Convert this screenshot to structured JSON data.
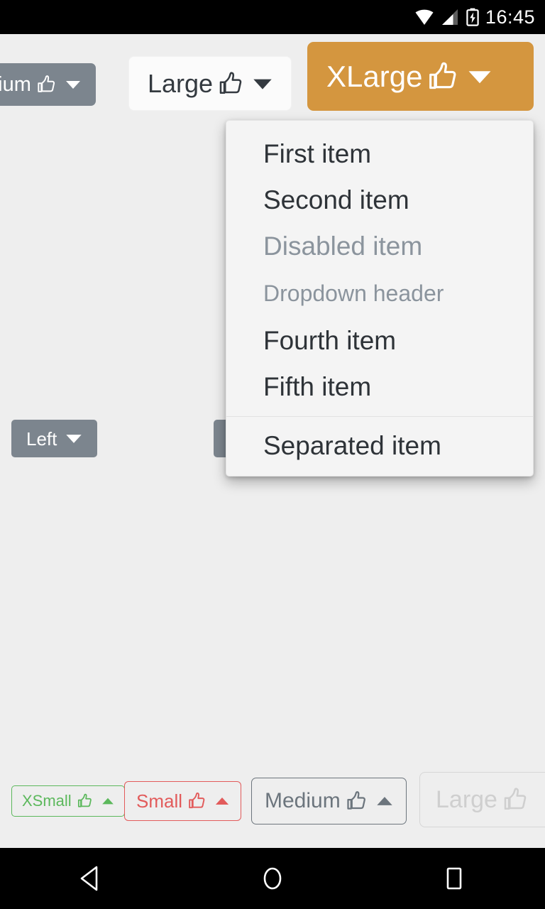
{
  "status_bar": {
    "time": "16:45",
    "icons": [
      "wifi-icon",
      "cellular-signal-icon",
      "battery-charging-icon"
    ]
  },
  "top_buttons": [
    {
      "label": "dium",
      "full_label": "Medium",
      "style": "secondary-filled",
      "color": "#7c858e",
      "text_color": "#ffffff",
      "thumb_icon": "thumbs-up-icon",
      "caret_icon": "caret-down-icon",
      "partially_offscreen": true
    },
    {
      "label": "Large",
      "style": "light-filled",
      "color": "#fbfbfb",
      "text_color": "#343a40",
      "thumb_icon": "thumbs-up-icon",
      "caret_icon": "caret-down-icon"
    },
    {
      "label": "XLarge",
      "style": "warning-filled",
      "color": "#d4963f",
      "text_color": "#ffffff",
      "thumb_icon": "thumbs-up-icon",
      "caret_icon": "caret-down-icon",
      "expanded": true
    }
  ],
  "middle_buttons": [
    {
      "label": "Left",
      "style": "secondary-filled",
      "color": "#7c858e",
      "text_color": "#ffffff",
      "caret_icon": "caret-down-icon"
    },
    {
      "label": "",
      "style": "secondary-filled",
      "color": "#7c858e",
      "text_color": "#ffffff",
      "obscured_by_dropdown": true
    }
  ],
  "dropdown": {
    "open": true,
    "anchor": "XLarge",
    "background": "#f4f4f4",
    "items": [
      {
        "label": "First item",
        "state": "enabled",
        "type": "item"
      },
      {
        "label": "Second item",
        "state": "enabled",
        "type": "item"
      },
      {
        "label": "Disabled item",
        "state": "disabled",
        "type": "item"
      },
      {
        "label": "Dropdown header",
        "state": "header",
        "type": "header"
      },
      {
        "label": "Fourth item",
        "state": "enabled",
        "type": "item"
      },
      {
        "label": "Fifth item",
        "state": "enabled",
        "type": "item"
      },
      {
        "label": "Separated item",
        "state": "enabled",
        "type": "item",
        "divider_before": true
      }
    ]
  },
  "bottom_buttons": [
    {
      "label": "XSmall",
      "style": "success-outline",
      "color": "#5cb85c",
      "thumb_icon": "thumbs-up-icon",
      "caret_icon": "caret-up-icon"
    },
    {
      "label": "Small",
      "style": "danger-outline",
      "color": "#e25b5b",
      "thumb_icon": "thumbs-up-icon",
      "caret_icon": "caret-up-icon"
    },
    {
      "label": "Medium",
      "style": "secondary-outline",
      "color": "#6c757d",
      "thumb_icon": "thumbs-up-icon",
      "caret_icon": "caret-up-icon"
    },
    {
      "label": "Large",
      "style": "light-outline",
      "color": "#cfcfcf",
      "thumb_icon": "thumbs-up-icon",
      "caret_icon": "caret-up-icon",
      "partially_offscreen": true
    }
  ],
  "nav_bar": {
    "back": "back-triangle-icon",
    "home": "home-circle-icon",
    "recents": "recents-square-icon"
  }
}
